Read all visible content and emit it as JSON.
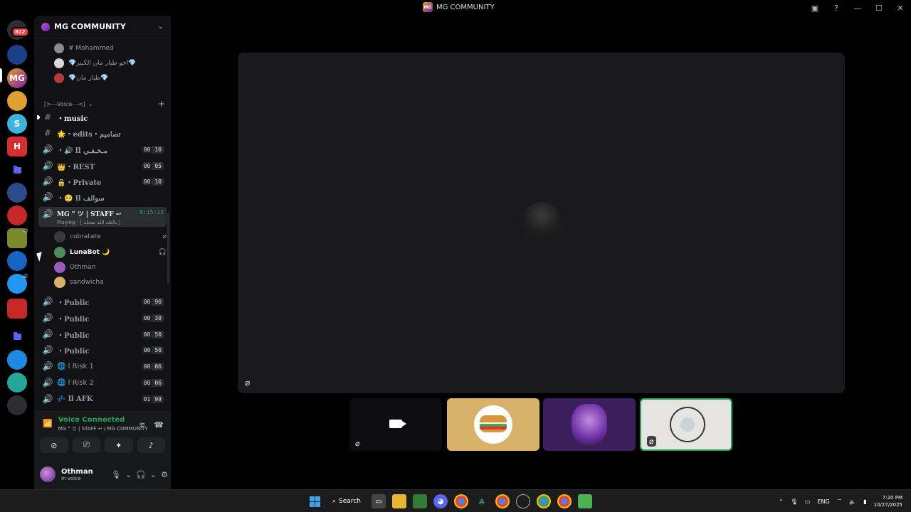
{
  "window": {
    "title": "MG COMMUNITY"
  },
  "rail": {
    "home_badge": "812"
  },
  "guild": {
    "name": "MG COMMUNITY"
  },
  "threads": [
    {
      "label": "# Mohammed",
      "color": "#8a8a8a"
    },
    {
      "label": "💎اخو طيار مان الكبير💎",
      "color": "#d8d8d8"
    },
    {
      "label": "💎طيار مان💎",
      "color": "#b43a3a"
    }
  ],
  "category": {
    "label": "[>---Voice---<]"
  },
  "channels": [
    {
      "icon": "#",
      "name": "・music",
      "counts": null
    },
    {
      "icon": "#",
      "name": "🌟・edits・تصاميم",
      "counts": null
    },
    {
      "icon": "🔊",
      "name": "・🔊 ll مـخـفـي",
      "counts": [
        "00",
        "10"
      ]
    },
    {
      "icon": "🔊",
      "name": "👑・REST",
      "counts": [
        "00",
        "05"
      ]
    },
    {
      "icon": "🔊",
      "name": "🔒・Private",
      "counts": [
        "00",
        "10"
      ]
    },
    {
      "icon": "🔊",
      "name": "・🥺 ll سوالف",
      "counts": null
    }
  ],
  "active_channel": {
    "name": "MG \" ツ | STAFF ↩",
    "subtitle": "Playing - [ بالقلة الله متحلة ]",
    "timer": "8:15:22"
  },
  "voice_users": [
    {
      "name": "cobratate",
      "color": "#3a3a3a"
    },
    {
      "name": "LunaBot 🌙",
      "color": "#4e8a5a"
    },
    {
      "name": "Othman",
      "color": "#9b5bbd"
    },
    {
      "name": "sandwicha",
      "color": "#d9b26a"
    }
  ],
  "channels_after": [
    {
      "icon": "🔊",
      "name": "・Public",
      "counts": [
        "00",
        "90"
      ]
    },
    {
      "icon": "🔊",
      "name": "・Public",
      "counts": [
        "00",
        "30"
      ]
    },
    {
      "icon": "🔊",
      "name": "・Public",
      "counts": [
        "00",
        "50"
      ]
    },
    {
      "icon": "🔊",
      "name": "・Public",
      "counts": [
        "00",
        "50"
      ]
    },
    {
      "icon": "🔊",
      "name": "🌐 l Risk 1",
      "counts": [
        "00",
        "06"
      ]
    },
    {
      "icon": "🔊",
      "name": "🌐 l Risk 2",
      "counts": [
        "00",
        "06"
      ]
    },
    {
      "icon": "🔊",
      "name": "💤 ll AFK",
      "counts": [
        "01",
        "99"
      ]
    }
  ],
  "voice_panel": {
    "status": "Voice Connected",
    "location": "MG \" ツ | STAFF ↩ / MG COMMUNITY"
  },
  "user": {
    "name": "Othman",
    "status": "In voice"
  },
  "taskbar": {
    "search_label": "Search",
    "lang": "ENG",
    "time": "7:20 PM",
    "date": "10/27/2025"
  }
}
